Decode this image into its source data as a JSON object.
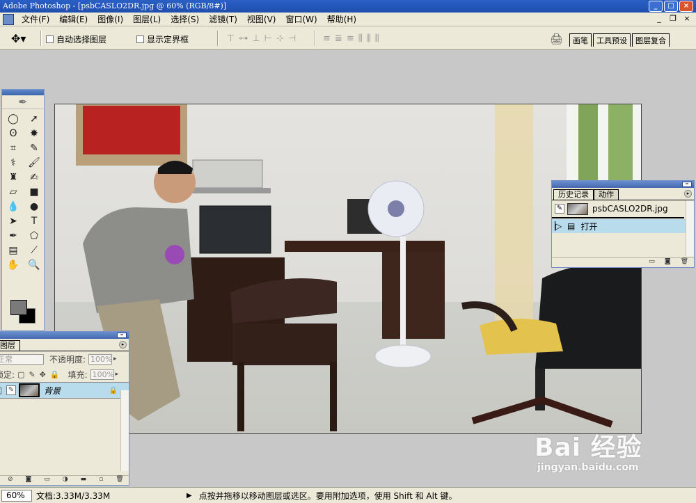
{
  "window": {
    "title": "Adobe Photoshop - [psbCASLO2DR.jpg @ 60% (RGB/8#)]",
    "buttons": [
      "_",
      "□",
      "×"
    ]
  },
  "menubar": {
    "items": [
      "文件(F)",
      "编辑(E)",
      "图像(I)",
      "图层(L)",
      "选择(S)",
      "滤镜(T)",
      "视图(V)",
      "窗口(W)",
      "帮助(H)"
    ],
    "mdi_buttons": [
      "_",
      "❐",
      "×"
    ]
  },
  "options": {
    "auto_select_label": "自动选择图层",
    "show_bounds_label": "显示定界框",
    "palette_tabs": [
      "画笔",
      "工具预设",
      "图层复合"
    ]
  },
  "history_panel": {
    "tabs": [
      "历史记录",
      "动作"
    ],
    "snapshot_name": "psbCASLO2DR.jpg",
    "states": [
      "打开"
    ]
  },
  "layers_panel": {
    "tab": "图层",
    "blend_mode": "正常",
    "opacity_label": "不透明度:",
    "opacity_value": "100%",
    "lock_label": "锁定:",
    "fill_label": "填充:",
    "fill_value": "100%",
    "layer_name": "背景"
  },
  "statusbar": {
    "zoom": "60%",
    "doc_info": "文档:3.33M/3.33M",
    "message": "点按并拖移以移动图层或选区。要用附加选项，使用 Shift 和 Alt 键。"
  },
  "watermark": {
    "logo": "Bai 经验",
    "url": "jingyan.baidu.com"
  }
}
